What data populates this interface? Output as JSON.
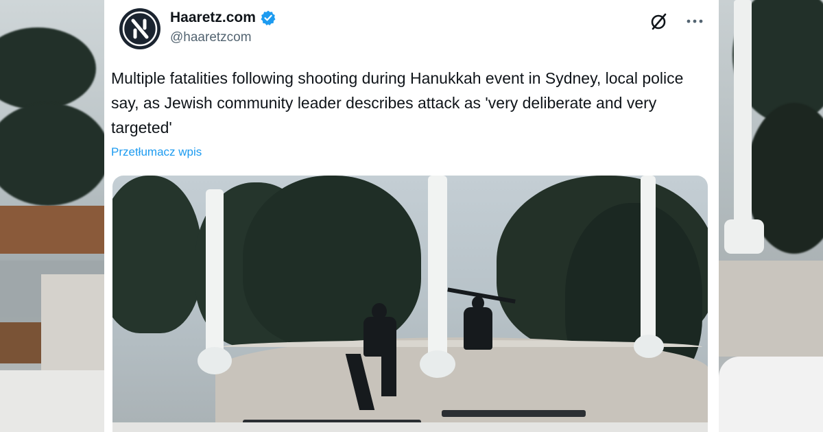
{
  "tweet": {
    "display_name": "Haaretz.com",
    "handle": "@haaretzcom",
    "text": "Multiple fatalities following shooting during Hanukkah event in Sydney, local police say, as Jewish community leader describes attack as 'very deliberate and very targeted'",
    "translate_label": "Przetłumacz wpis",
    "verified": true
  },
  "icons": {
    "avatar": "haaretz-logo-icon",
    "verified": "verified-badge-icon",
    "grok": "grok-icon",
    "more": "more-options-icon"
  },
  "colors": {
    "accent": "#1d9bf0",
    "text": "#0f1419",
    "secondary": "#536471"
  }
}
